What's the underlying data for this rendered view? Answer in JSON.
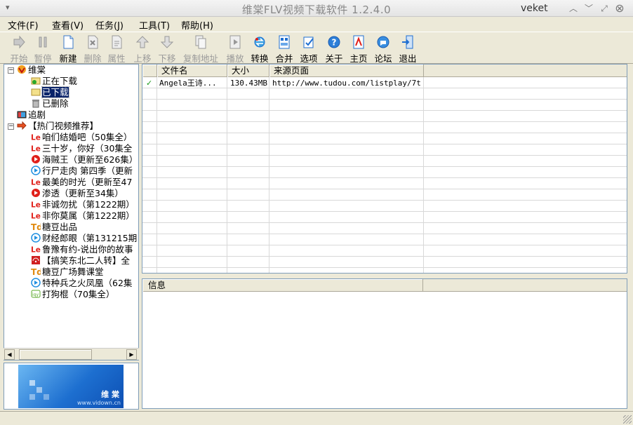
{
  "window": {
    "title": "维棠FLV视频下载软件 1.2.4.0",
    "user": "veket",
    "sys_menu_icon": "chevron-down-icon",
    "controls": [
      "minimize-icon",
      "restore-icon",
      "maximize-icon",
      "close-icon"
    ]
  },
  "menu": [
    "文件(F)",
    "查看(V)",
    "任务(J)",
    "工具(T)",
    "帮助(H)"
  ],
  "toolbar": [
    {
      "label": "开始",
      "icon": "play-arrow-icon",
      "enabled": false
    },
    {
      "label": "暂停",
      "icon": "pause-icon",
      "enabled": false
    },
    {
      "label": "新建",
      "icon": "new-file-icon",
      "enabled": true
    },
    {
      "label": "删除",
      "icon": "delete-icon",
      "enabled": false
    },
    {
      "label": "属性",
      "icon": "properties-icon",
      "enabled": false
    },
    {
      "label": "上移",
      "icon": "move-up-icon",
      "enabled": false
    },
    {
      "label": "下移",
      "icon": "move-down-icon",
      "enabled": false
    },
    {
      "label": "复制地址",
      "icon": "copy-icon",
      "enabled": false
    },
    {
      "label": "播放",
      "icon": "play-file-icon",
      "enabled": false
    },
    {
      "label": "转换",
      "icon": "convert-icon",
      "enabled": true
    },
    {
      "label": "合并",
      "icon": "merge-icon",
      "enabled": true
    },
    {
      "label": "选项",
      "icon": "options-icon",
      "enabled": true
    },
    {
      "label": "关于",
      "icon": "help-icon",
      "enabled": true
    },
    {
      "label": "主页",
      "icon": "homepage-icon",
      "enabled": true
    },
    {
      "label": "论坛",
      "icon": "forum-icon",
      "enabled": true
    },
    {
      "label": "退出",
      "icon": "exit-icon",
      "enabled": true
    }
  ],
  "tree": {
    "root": "维棠",
    "root_children": [
      "正在下载",
      "已下载",
      "已删除"
    ],
    "selected": "已下载",
    "drama": "追剧",
    "hot": "【热门视频推荐】",
    "hot_items": [
      {
        "label": "咱们结婚吧（50集全）",
        "source": "le"
      },
      {
        "label": "三十岁，你好（30集全",
        "source": "le"
      },
      {
        "label": "海贼王（更新至626集）",
        "source": "tudou"
      },
      {
        "label": "行尸走肉 第四季（更新",
        "source": "youku"
      },
      {
        "label": "最美的时光（更新至47",
        "source": "le"
      },
      {
        "label": "渗透（更新至34集）",
        "source": "tudou"
      },
      {
        "label": "非诚勿扰（第1222期）",
        "source": "le"
      },
      {
        "label": "非你莫属（第1222期）",
        "source": "le"
      },
      {
        "label": "糖豆出品",
        "source": "tangdou"
      },
      {
        "label": "财经郎眼（第131215期",
        "source": "youku"
      },
      {
        "label": "鲁豫有约-说出你的故事",
        "source": "le"
      },
      {
        "label": "【搞笑东北二人转】全",
        "source": "other"
      },
      {
        "label": "糖豆广场舞课堂",
        "source": "tangdou"
      },
      {
        "label": "特种兵之火凤凰（62集",
        "source": "youku"
      },
      {
        "label": "打狗棍（70集全）",
        "source": "iqiyi"
      }
    ]
  },
  "banner": {
    "brand": "维 棠",
    "url": "www.vidown.cn"
  },
  "list": {
    "columns": [
      "文件名",
      "大小",
      "来源页面"
    ],
    "rows": [
      {
        "status_icon": "checkmark-icon",
        "name": "Angela王诗...",
        "size": "130.43MB",
        "source": "http://www.tudou.com/listplay/7t..."
      }
    ]
  },
  "info": {
    "header": "信息"
  },
  "colors": {
    "selection": "#0a246a",
    "le_red": "#e0201a",
    "check_green": "#1a9a1a",
    "toolbar_blue": "#1f6fd1"
  }
}
